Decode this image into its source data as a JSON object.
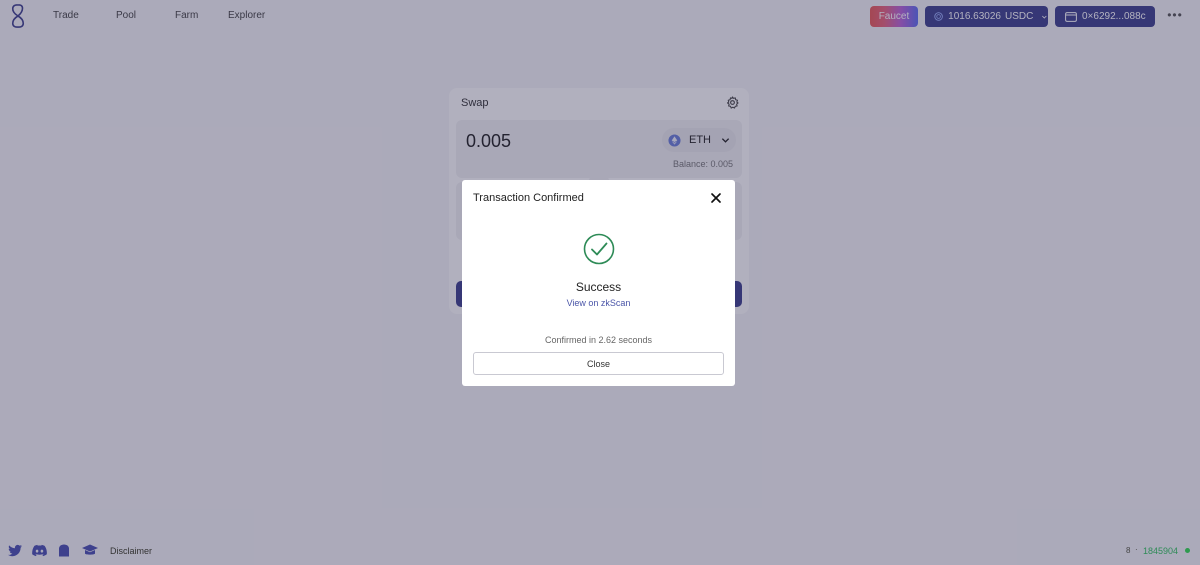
{
  "nav": {
    "links": [
      "Trade",
      "Pool",
      "Farm",
      "Explorer"
    ],
    "faucet_label": "Faucet",
    "balance": {
      "amount": "1016.63026",
      "unit": "USDC"
    },
    "wallet_address": "0×6292...088c",
    "more_label": "•••"
  },
  "swap": {
    "title": "Swap",
    "from_amount": "0.005",
    "from_token": "ETH",
    "balance_label": "Balance: 0.005"
  },
  "modal": {
    "title": "Transaction Confirmed",
    "status": "Success",
    "link_text": "View on zkScan",
    "confirmed_text": "Confirmed in 2.62 seconds",
    "close_label": "Close"
  },
  "footer": {
    "disclaimer": "Disclaimer",
    "chain_id": "8",
    "separator": "·",
    "block_number": "1845904"
  },
  "colors": {
    "primary": "#3e418d",
    "success": "#2e8b57",
    "link": "#4a55a8"
  }
}
